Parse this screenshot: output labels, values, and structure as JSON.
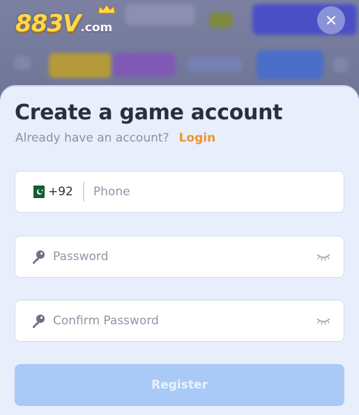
{
  "brand": {
    "logo_main": "883V",
    "logo_sub": ".com",
    "accent": "#f0932a",
    "logo_color": "#ffd84a"
  },
  "header": {
    "close_icon": "close-icon"
  },
  "modal": {
    "title": "Create a game account",
    "subtitle": "Already have an account?",
    "login_link": "Login"
  },
  "form": {
    "phone": {
      "country_flag": "pakistan-flag-icon",
      "country_code": "+92",
      "placeholder": "Phone",
      "value": ""
    },
    "password": {
      "placeholder": "Password",
      "value": "",
      "icon": "key-icon",
      "toggle_icon": "eye-closed-icon"
    },
    "confirm_password": {
      "placeholder": "Confirm Password",
      "value": "",
      "icon": "key-icon",
      "toggle_icon": "eye-closed-icon"
    },
    "register_label": "Register",
    "register_color": "#a9caf6"
  }
}
